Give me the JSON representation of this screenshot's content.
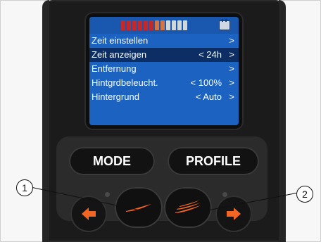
{
  "screen": {
    "battery_segments": [
      "full",
      "full",
      "full",
      "full",
      "full",
      "full",
      "mid",
      "mid",
      "low",
      "low",
      "low",
      "low"
    ],
    "menu": [
      {
        "label": "Zeit einstellen",
        "value": "",
        "chevron": ">",
        "selected": false
      },
      {
        "label": "Zeit anzeigen",
        "value": "< 24h",
        "chevron": ">",
        "selected": true
      },
      {
        "label": "Entfernung",
        "value": "",
        "chevron": ">",
        "selected": false
      },
      {
        "label": "Hintgrdbeleucht.",
        "value": "< 100%",
        "chevron": ">",
        "selected": false
      },
      {
        "label": "Hintergrund",
        "value": "< Auto",
        "chevron": ">",
        "selected": false
      }
    ]
  },
  "buttons": {
    "mode": "MODE",
    "profile": "PROFILE"
  },
  "callouts": {
    "one": "1",
    "two": "2"
  },
  "colors": {
    "lcd_bg": "#1c62c0",
    "row_selected": "#0d2e64",
    "accent": "#f26522"
  },
  "icons": {
    "left_arrow": "left-arrow-icon",
    "right_arrow": "right-arrow-icon",
    "swoosh": "swoosh-icon"
  }
}
